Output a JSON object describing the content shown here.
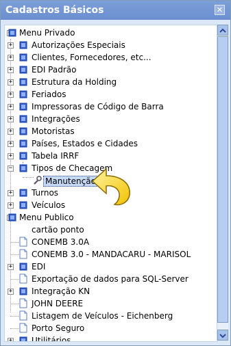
{
  "window": {
    "title": "Cadastros Básicos",
    "close_glyph": "✕"
  },
  "tree": {
    "root_private": "Menu Privado",
    "private_items": [
      "Autorizações Especiais",
      "Clientes, Fornecedores, etc...",
      "EDI Padrão",
      "Estrutura da Holding",
      "Feriados",
      "Impressoras de Código de Barra",
      "Integrações",
      "Motoristas",
      "Países, Estados e Cidades",
      "Tabela IRRF",
      "Tipos de Checagem",
      "Manutenção",
      "Turnos",
      "Veículos"
    ],
    "root_public": "Menu Publico",
    "public_items": [
      "cartão ponto",
      "CONEMB 3.0A",
      "CONEMB 3.0 - MANDACARU - MARISOL",
      "EDI",
      "Exportação de dados para SQL-Server",
      "Integração KN",
      "JOHN DEERE",
      "Listagem de Veículos - Eichenberg",
      "Porto Seguro",
      "Utilitários"
    ],
    "selected": "Manutenção"
  },
  "icons": {
    "folder_node": "folder-node-icon",
    "document": "document-icon",
    "wrench": "wrench-icon",
    "pointer": "curved-arrow-pointer-icon"
  },
  "colors": {
    "accent": "#6b8fcf",
    "selection": "#c6d9f7",
    "node_blue": "#2e5bd6"
  }
}
